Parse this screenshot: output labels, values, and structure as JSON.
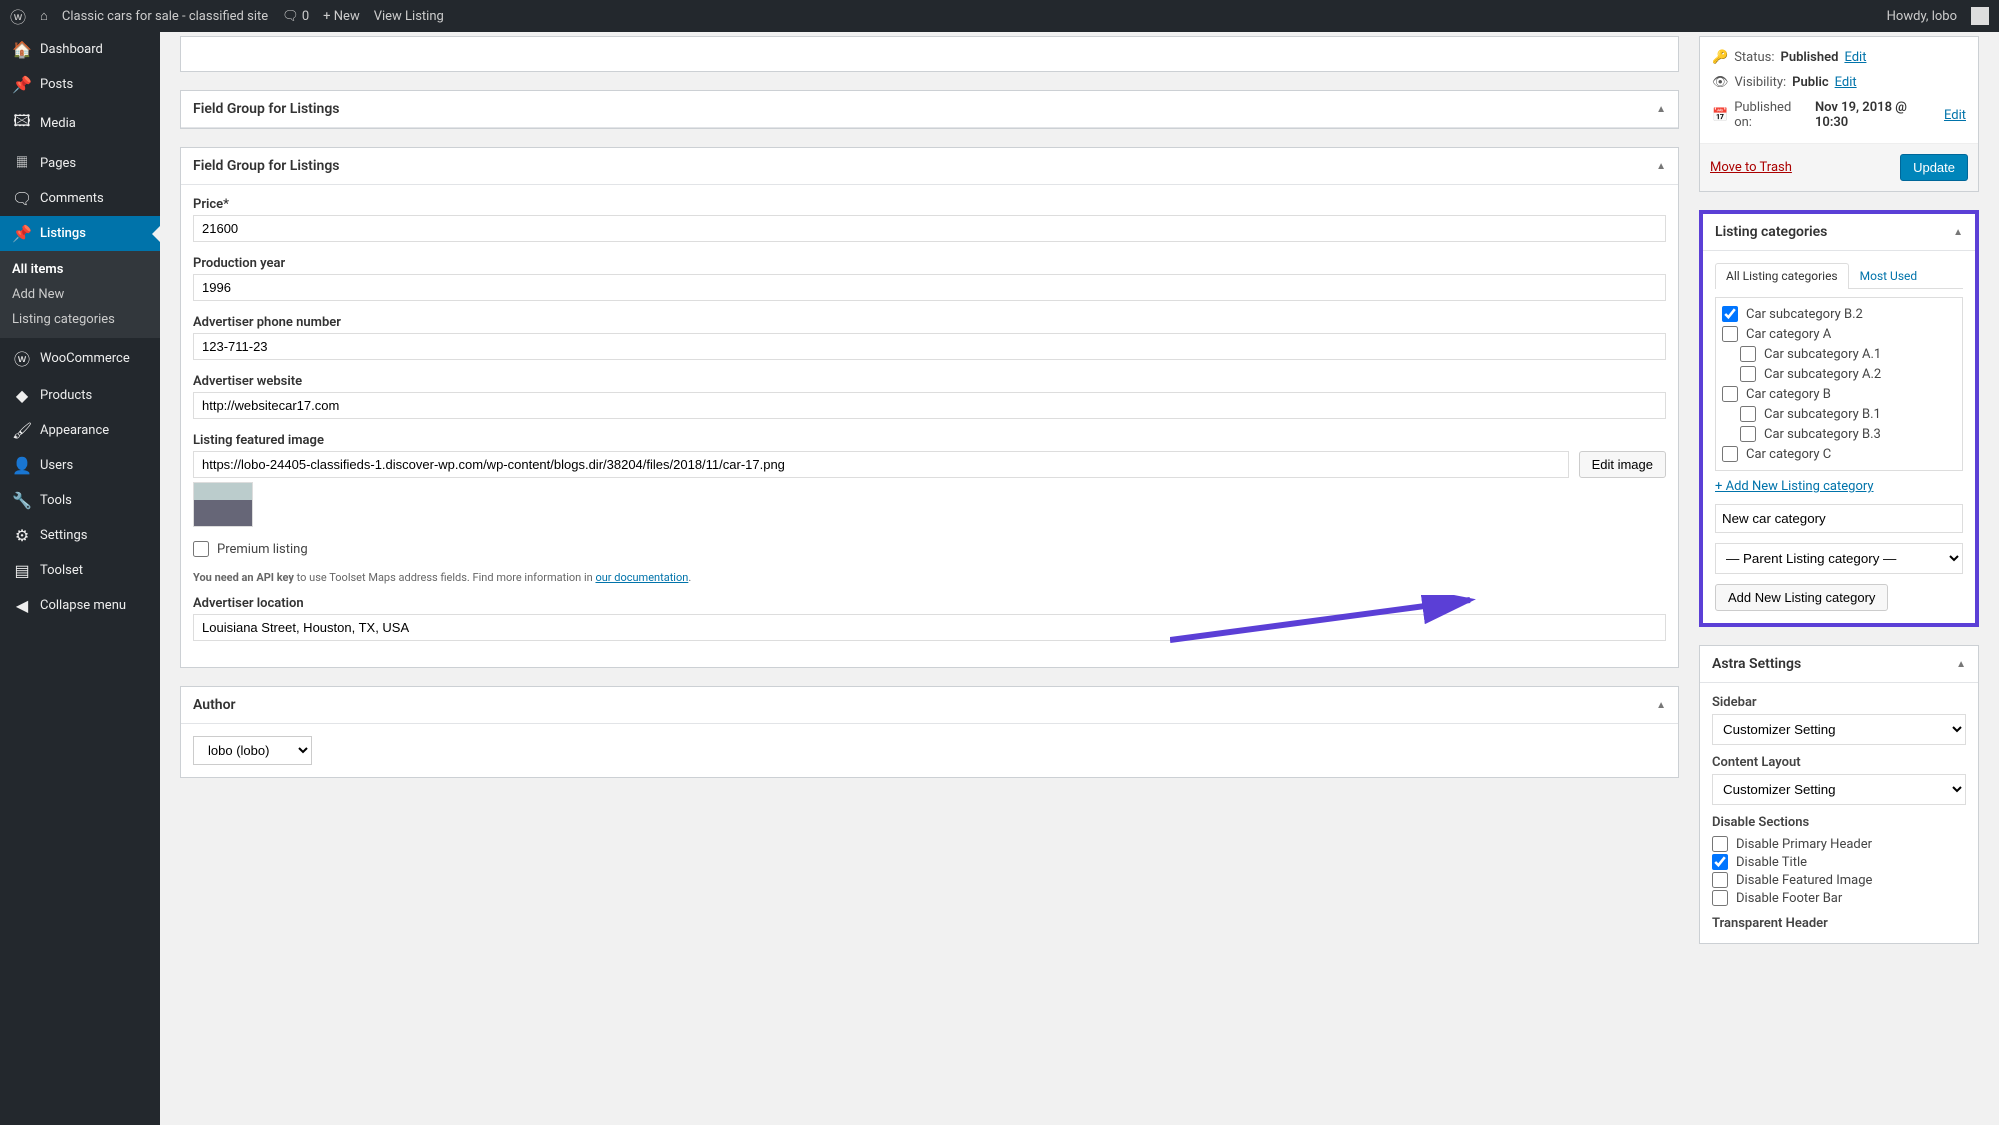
{
  "adminbar": {
    "site_title": "Classic cars for sale - classified site",
    "comments_count": "0",
    "new_label": "New",
    "view_listing": "View Listing",
    "howdy": "Howdy, lobo"
  },
  "sidebar": {
    "dashboard": "Dashboard",
    "posts": "Posts",
    "media": "Media",
    "pages": "Pages",
    "comments": "Comments",
    "listings": "Listings",
    "listings_sub": {
      "all": "All items",
      "add": "Add New",
      "cats": "Listing categories"
    },
    "woocommerce": "WooCommerce",
    "products": "Products",
    "appearance": "Appearance",
    "users": "Users",
    "tools": "Tools",
    "settings": "Settings",
    "toolset": "Toolset",
    "collapse": "Collapse menu"
  },
  "panels": {
    "fg1_title": "Field Group for Listings",
    "fg2_title": "Field Group for Listings",
    "author_title": "Author"
  },
  "fields": {
    "price_label": "Price*",
    "price_value": "21600",
    "year_label": "Production year",
    "year_value": "1996",
    "phone_label": "Advertiser phone number",
    "phone_value": "123-711-23",
    "website_label": "Advertiser website",
    "website_value": "http://websitecar17.com",
    "image_label": "Listing featured image",
    "image_value": "https://lobo-24405-classifieds-1.discover-wp.com/wp-content/blogs.dir/38204/files/2018/11/car-17.png",
    "edit_image": "Edit image",
    "premium_label": "Premium listing",
    "api_hint_prefix": "You need an API key",
    "api_hint_mid": " to use Toolset Maps address fields. Find more information in ",
    "api_hint_link": "our documentation",
    "location_label": "Advertiser location",
    "location_value": "Louisiana Street, Houston, TX, USA",
    "author_value": "lobo (lobo)"
  },
  "publish": {
    "status_label": "Status:",
    "status_value": "Published",
    "visibility_label": "Visibility:",
    "visibility_value": "Public",
    "publishedon_label": "Published on:",
    "publishedon_value": "Nov 19, 2018 @ 10:30",
    "edit": "Edit",
    "trash": "Move to Trash",
    "update": "Update"
  },
  "categories": {
    "title": "Listing categories",
    "tab_all": "All Listing categories",
    "tab_most": "Most Used",
    "items": [
      {
        "label": "Car subcategory B.2",
        "checked": true,
        "indent": 1
      },
      {
        "label": "Car category A",
        "checked": false,
        "indent": 1
      },
      {
        "label": "Car subcategory A.1",
        "checked": false,
        "indent": 2
      },
      {
        "label": "Car subcategory A.2",
        "checked": false,
        "indent": 2
      },
      {
        "label": "Car category B",
        "checked": false,
        "indent": 1
      },
      {
        "label": "Car subcategory B.1",
        "checked": false,
        "indent": 2
      },
      {
        "label": "Car subcategory B.3",
        "checked": false,
        "indent": 2
      },
      {
        "label": "Car category C",
        "checked": false,
        "indent": 1
      }
    ],
    "add_link": "+ Add New Listing category",
    "new_placeholder": "New car category",
    "parent_placeholder": "— Parent Listing category —",
    "add_btn": "Add New Listing category"
  },
  "astra": {
    "title": "Astra Settings",
    "sidebar_label": "Sidebar",
    "sidebar_value": "Customizer Setting",
    "content_label": "Content Layout",
    "content_value": "Customizer Setting",
    "disable_sections": "Disable Sections",
    "d1": "Disable Primary Header",
    "d2": "Disable Title",
    "d3": "Disable Featured Image",
    "d4": "Disable Footer Bar",
    "transparent": "Transparent Header"
  }
}
